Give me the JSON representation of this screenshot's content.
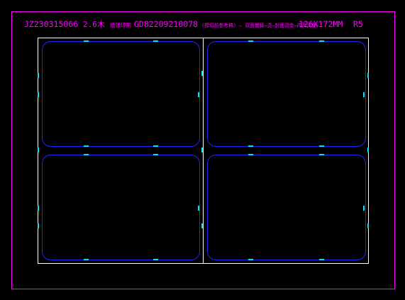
{
  "header": {
    "job_code": "JZ230315066",
    "thickness": "2.6木",
    "note_1": "纸张印刷",
    "order_code": "GD82209210078",
    "spec_notes": "(模切前参考稿) — 双面覆膜—烫—封面烫金—内页烫金—",
    "size": "126X172MM",
    "rev": "R5"
  },
  "colors": {
    "frame": "#ff00ff",
    "sheet": "#ffffff",
    "die": "#2222ff",
    "marks": "#00e5ff",
    "background": "#000000"
  }
}
